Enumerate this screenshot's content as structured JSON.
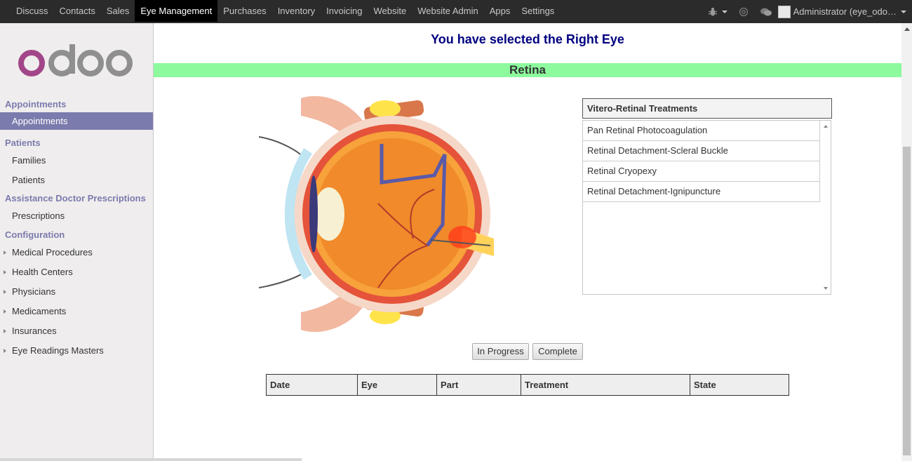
{
  "topbar": {
    "menu": [
      "Discuss",
      "Contacts",
      "Sales",
      "Eye Management",
      "Purchases",
      "Inventory",
      "Invoicing",
      "Website",
      "Website Admin",
      "Apps",
      "Settings"
    ],
    "active_index": 3,
    "user": "Administrator (eye_odo…"
  },
  "sidebar": {
    "logo_text": "odoo",
    "sections": {
      "appointments": "Appointments",
      "patients": "Patients",
      "assistance": "Assistance Doctor Prescriptions",
      "configuration": "Configuration"
    },
    "items": {
      "appointments": "Appointments",
      "families": "Families",
      "patients": "Patients",
      "prescriptions": "Prescriptions",
      "medical_procedures": "Medical Procedures",
      "health_centers": "Health Centers",
      "physicians": "Physicians",
      "medicaments": "Medicaments",
      "insurances": "Insurances",
      "eye_readings": "Eye Readings Masters"
    }
  },
  "main": {
    "heading": "You have selected the Right Eye",
    "section_title": "Retina",
    "treatments": {
      "header": "Vitero-Retinal Treatments",
      "items": [
        "Pan Retinal Photocoagulation",
        "Retinal Detachment-Scleral Buckle",
        "Retinal Cryopexy",
        "Retinal Detachment-Ignipuncture"
      ]
    },
    "buttons": {
      "in_progress": "In Progress",
      "complete": "Complete"
    },
    "table": {
      "columns": [
        "Date",
        "Eye",
        "Part",
        "Treatment",
        "State"
      ]
    }
  },
  "colors": {
    "accent": "#7c7bad",
    "band": "#8cfa9d",
    "heading": "#000080",
    "topbar": "#2b2b2b"
  }
}
